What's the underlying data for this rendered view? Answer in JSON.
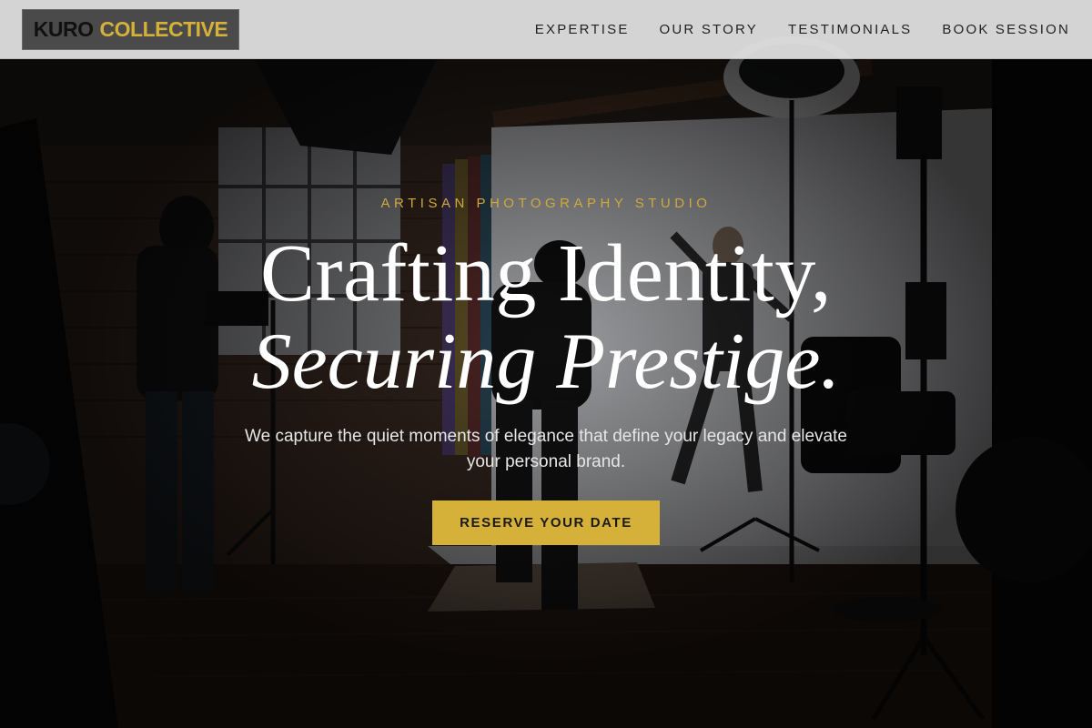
{
  "brand": {
    "name_part1": "KURO",
    "name_part2": "COLLECTIVE"
  },
  "nav": {
    "items": [
      {
        "label": "EXPERTISE"
      },
      {
        "label": "OUR STORY"
      },
      {
        "label": "TESTIMONIALS"
      },
      {
        "label": "BOOK SESSION"
      }
    ]
  },
  "hero": {
    "eyebrow": "ARTISAN PHOTOGRAPHY STUDIO",
    "title_line1": "Crafting Identity,",
    "title_line2": "Securing Prestige.",
    "subtitle": "We capture the quiet moments of elegance that define your legacy and elevate your personal brand.",
    "cta_label": "RESERVE YOUR DATE",
    "background": "photography-studio-scene"
  },
  "colors": {
    "accent": "#d6b13a",
    "header_bg": "#e4e4e4",
    "logo_bg": "#4a4a4a",
    "text_light": "#ffffff",
    "nav_text": "#222222"
  }
}
